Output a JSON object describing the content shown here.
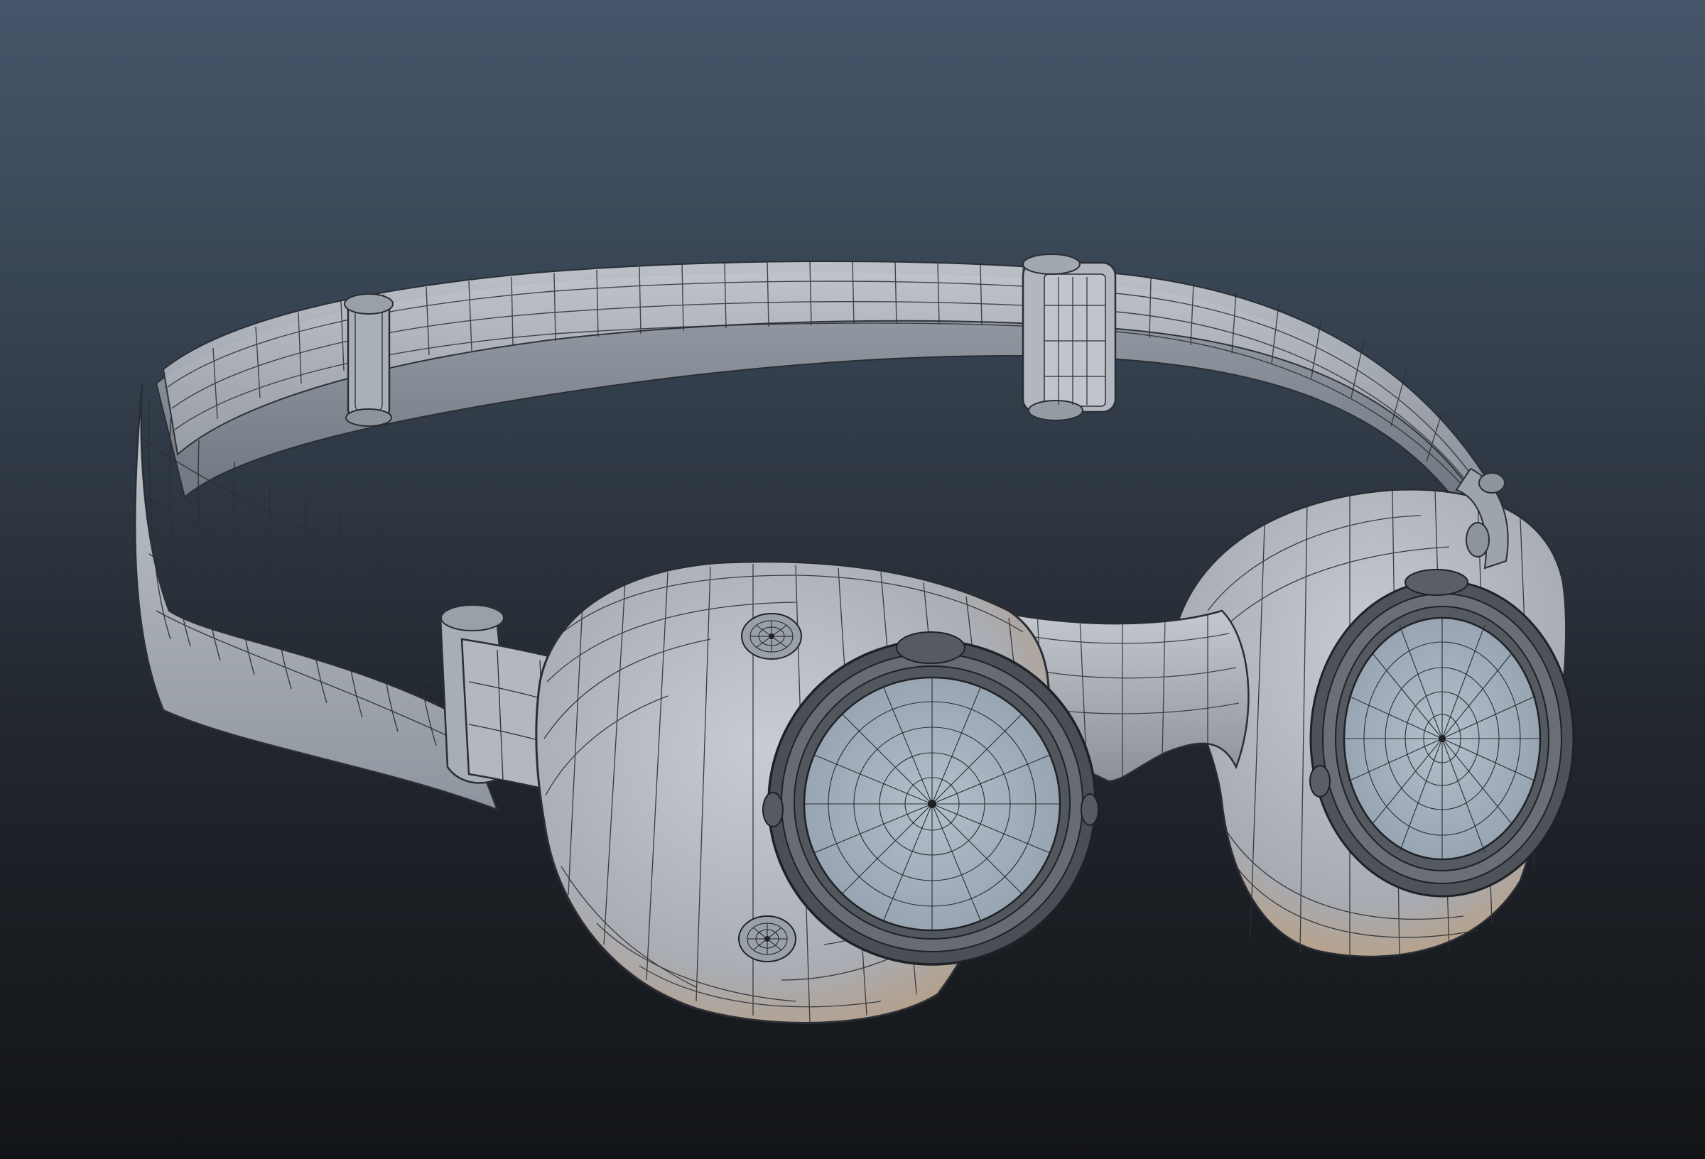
{
  "viewport": {
    "background_top": "#46566a",
    "background_bottom": "#121417"
  },
  "model": {
    "object": "goggles",
    "display_mode": "shaded-wireframe",
    "surface_color": "#b9bec6",
    "wire_color": "#1e2126",
    "lens_color": "#a9b6c3",
    "rim_color": "#5b5f66",
    "warm_tint": "#c69a6a"
  }
}
